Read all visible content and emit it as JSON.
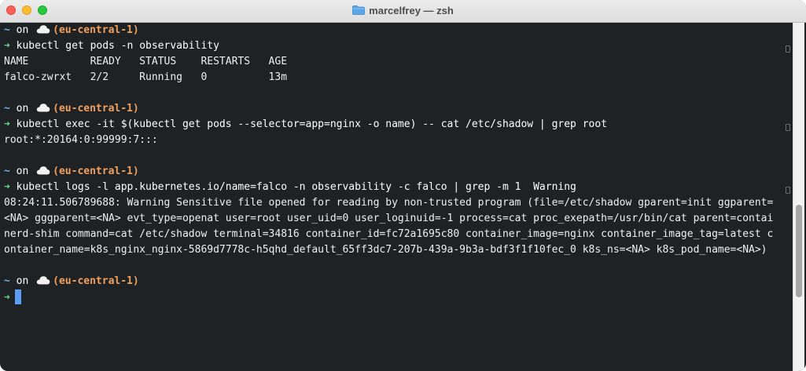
{
  "window": {
    "title": "marcelfrey — zsh",
    "folder_icon": "folder-icon"
  },
  "prompt": {
    "tilde": "~",
    "on": "on",
    "context": "(eu-central-1)",
    "arrow": "➜",
    "cloud_icon": "cloud-icon"
  },
  "blocks": [
    {
      "command": "kubectl get pods -n observability",
      "output": [
        "NAME          READY   STATUS    RESTARTS   AGE",
        "falco-zwrxt   2/2     Running   0          13m"
      ]
    },
    {
      "command": "kubectl exec -it $(kubectl get pods --selector=app=nginx -o name) -- cat /etc/shadow | grep root",
      "output": [
        "root:*:20164:0:99999:7:::"
      ]
    },
    {
      "command": "kubectl logs -l app.kubernetes.io/name=falco -n observability -c falco | grep -m 1  Warning",
      "output": [
        "08:24:11.506789688: Warning Sensitive file opened for reading by non-trusted program (file=/etc/shadow gparent=init ggparent=",
        "<NA> gggparent=<NA> evt_type=openat user=root user_uid=0 user_loginuid=-1 process=cat proc_exepath=/usr/bin/cat parent=contai",
        "nerd-shim command=cat /etc/shadow terminal=34816 container_id=fc72a1695c80 container_image=nginx container_image_tag=latest c",
        "ontainer_name=k8s_nginx_nginx-5869d7778c-h5qhd_default_65ff3dc7-207b-439a-9b3a-bdf3f1f10fec_0 k8s_ns=<NA> k8s_pod_name=<NA>)"
      ]
    }
  ],
  "colors": {
    "background": "#1f2224",
    "prompt_tilde": "#74aef0",
    "prompt_arrow": "#62d98a",
    "prompt_context": "#f0a060",
    "cursor": "#5b9cf6"
  }
}
